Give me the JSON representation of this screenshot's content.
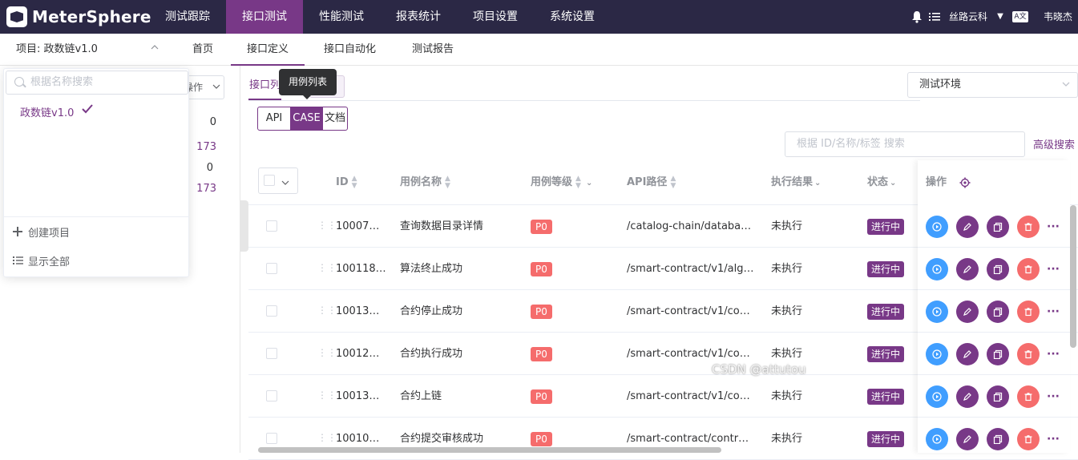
{
  "app": {
    "logo_text": "MeterSphere"
  },
  "topnav": [
    {
      "label": "测试跟踪"
    },
    {
      "label": "接口测试",
      "active": true
    },
    {
      "label": "性能测试"
    },
    {
      "label": "报表统计"
    },
    {
      "label": "项目设置"
    },
    {
      "label": "系统设置"
    }
  ],
  "topright": {
    "workspace": "丝路云科",
    "user": "韦晓杰",
    "lang_icon": "A文"
  },
  "subbar": {
    "project_label": "项目: 政数链v1.0",
    "tabs": [
      {
        "label": "首页"
      },
      {
        "label": "接口定义",
        "active": true
      },
      {
        "label": "接口自动化"
      },
      {
        "label": "测试报告"
      }
    ]
  },
  "left": {
    "ops_label": "操作",
    "counts": [
      "0",
      "173",
      "0",
      "173"
    ]
  },
  "project_dropdown": {
    "search_placeholder": "根据名称搜索",
    "items": [
      {
        "label": "政数链v1.0",
        "selected": true
      }
    ],
    "create_label": "创建项目",
    "show_all_label": "显示全部"
  },
  "main": {
    "tab_api_label": "接口列",
    "tooltip": "用例列表",
    "env_label": "测试环境",
    "modes": [
      {
        "label": "API"
      },
      {
        "label": "CASE",
        "selected": true
      },
      {
        "label": "文档"
      }
    ],
    "search_placeholder": "根据 ID/名称/标签 搜索",
    "advanced_search": "高级搜索"
  },
  "table": {
    "headers": {
      "id": "ID",
      "name": "用例名称",
      "level": "用例等级",
      "path": "API路径",
      "result": "执行结果",
      "status": "状态",
      "ops": "操作"
    },
    "rows": [
      {
        "id": "10007…",
        "name": "查询数据目录详情",
        "level": "P0",
        "path": "/catalog-chain/databas…",
        "result": "未执行",
        "status": "进行中"
      },
      {
        "id": "100118…",
        "name": "算法终止成功",
        "level": "P0",
        "path": "/smart-contract/v1/algo…",
        "result": "未执行",
        "status": "进行中"
      },
      {
        "id": "10013…",
        "name": "合约停止成功",
        "level": "P0",
        "path": "/smart-contract/v1/cont…",
        "result": "未执行",
        "status": "进行中"
      },
      {
        "id": "10012…",
        "name": "合约执行成功",
        "level": "P0",
        "path": "/smart-contract/v1/cont…",
        "result": "未执行",
        "status": "进行中"
      },
      {
        "id": "10013…",
        "name": "合约上链",
        "level": "P0",
        "path": "/smart-contract/v1/cont…",
        "result": "未执行",
        "status": "进行中"
      },
      {
        "id": "10010…",
        "name": "合约提交审核成功",
        "level": "P0",
        "path": "/smart-contract/contrac…",
        "result": "未执行",
        "status": "进行中"
      }
    ]
  },
  "colors": {
    "brand": "#783887",
    "topbar": "#2b2845",
    "danger": "#f56c6c",
    "run": "#409eff"
  },
  "watermark": "CSDN @attutou"
}
